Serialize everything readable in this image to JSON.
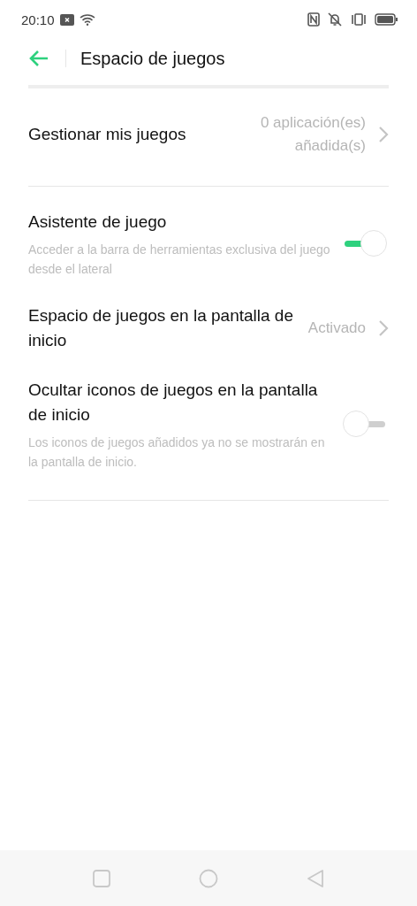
{
  "status_bar": {
    "time": "20:10"
  },
  "header": {
    "title": "Espacio de juegos"
  },
  "sections": [
    {
      "items": [
        {
          "kind": "link",
          "title": "Gestionar mis juegos",
          "value": "0 aplicación(es) añadida(s)"
        }
      ]
    },
    {
      "items": [
        {
          "kind": "toggle",
          "title": "Asistente de juego",
          "description": "Acceder a la barra de herramientas exclusiva del juego desde el lateral",
          "on": true
        },
        {
          "kind": "link",
          "title": "Espacio de juegos en la pantalla de inicio",
          "value": "Activado"
        },
        {
          "kind": "toggle",
          "title": "Ocultar iconos de juegos en la pantalla de inicio",
          "description": "Los iconos de juegos añadidos ya no se mostrarán en la pantalla de inicio.",
          "on": false
        }
      ]
    }
  ]
}
